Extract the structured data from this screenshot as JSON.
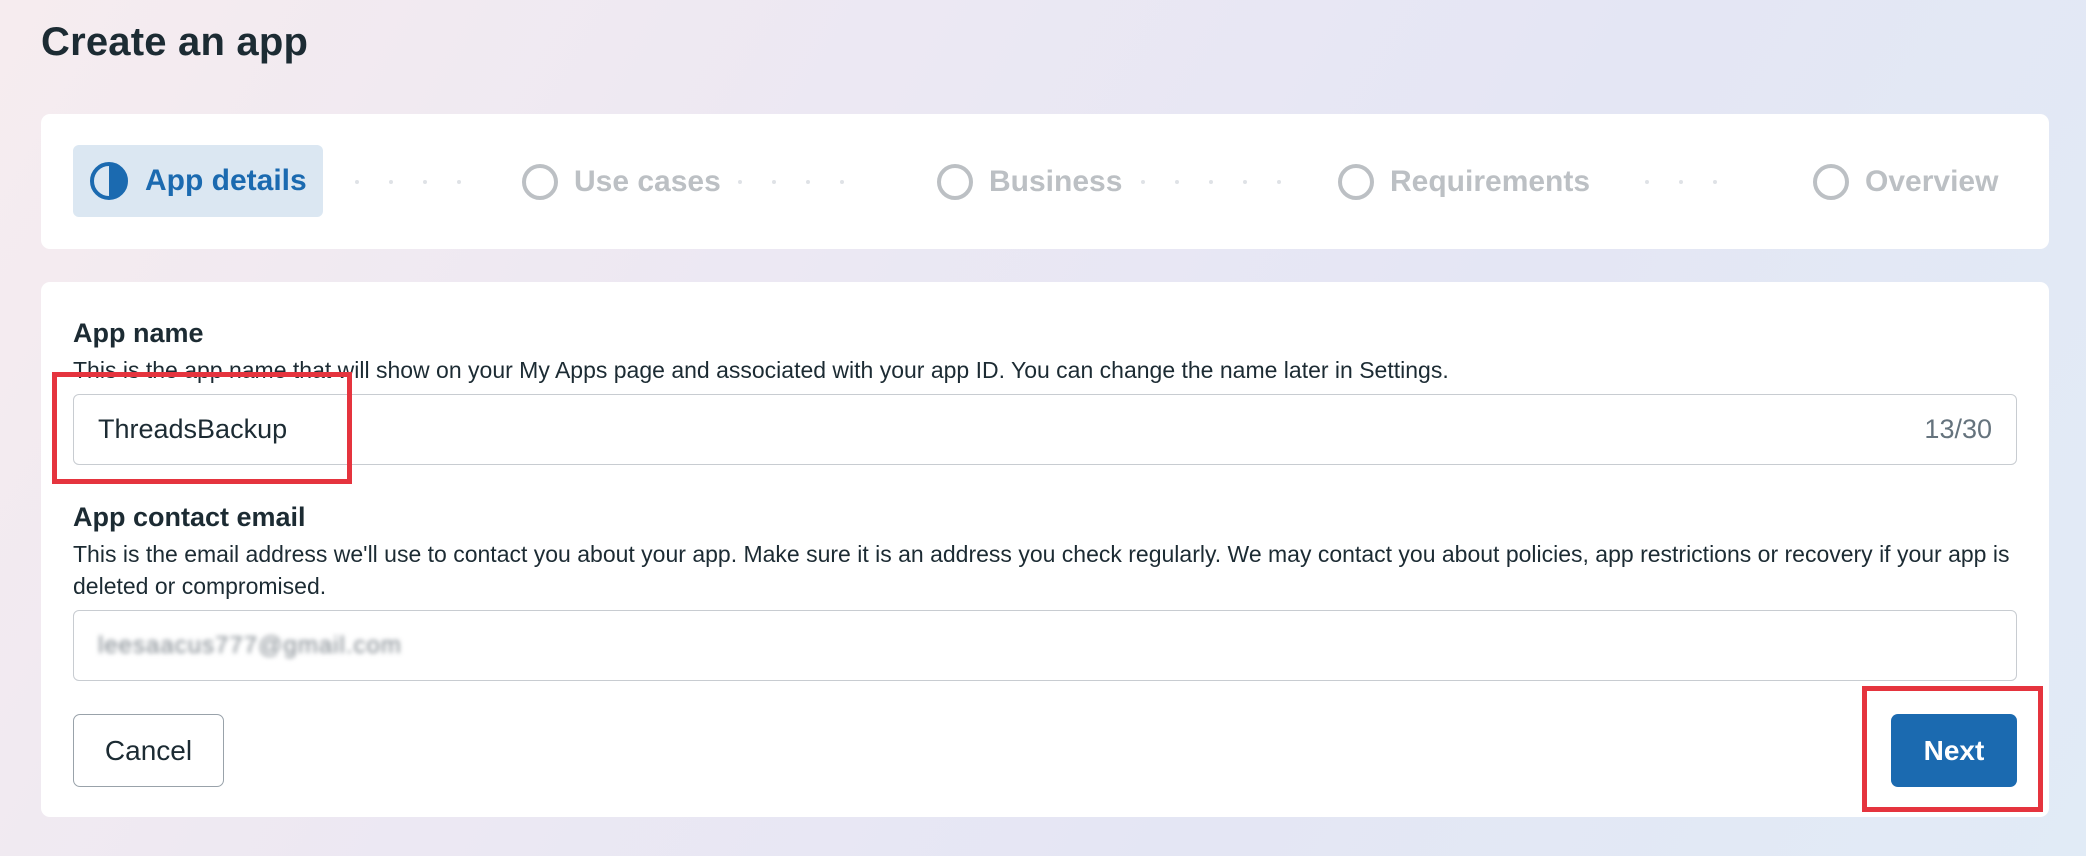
{
  "page": {
    "title": "Create an app"
  },
  "stepper": {
    "steps": [
      {
        "label": "App details",
        "state": "active",
        "icon": "half-circle-icon"
      },
      {
        "label": "Use cases",
        "state": "pending",
        "icon": "circle-icon"
      },
      {
        "label": "Business",
        "state": "pending",
        "icon": "circle-icon"
      },
      {
        "label": "Requirements",
        "state": "pending",
        "icon": "circle-icon"
      },
      {
        "label": "Overview",
        "state": "pending",
        "icon": "circle-icon"
      }
    ]
  },
  "form": {
    "app_name": {
      "title": "App name",
      "description": "This is the app name that will show on your My Apps page and associated with your app ID. You can change the name later in Settings.",
      "value": "ThreadsBackup",
      "char_count": "13/30"
    },
    "contact_email": {
      "title": "App contact email",
      "description": "This is the email address we'll use to contact you about your app. Make sure it is an address you check regularly. We may contact you about policies, app restrictions or recovery if your app is deleted or compromised.",
      "value": "leesaacus777@gmail.com"
    }
  },
  "actions": {
    "cancel_label": "Cancel",
    "next_label": "Next"
  },
  "colors": {
    "accent": "#1b6ab0",
    "highlight": "#e5343e",
    "inactive": "#bcc0c4"
  }
}
